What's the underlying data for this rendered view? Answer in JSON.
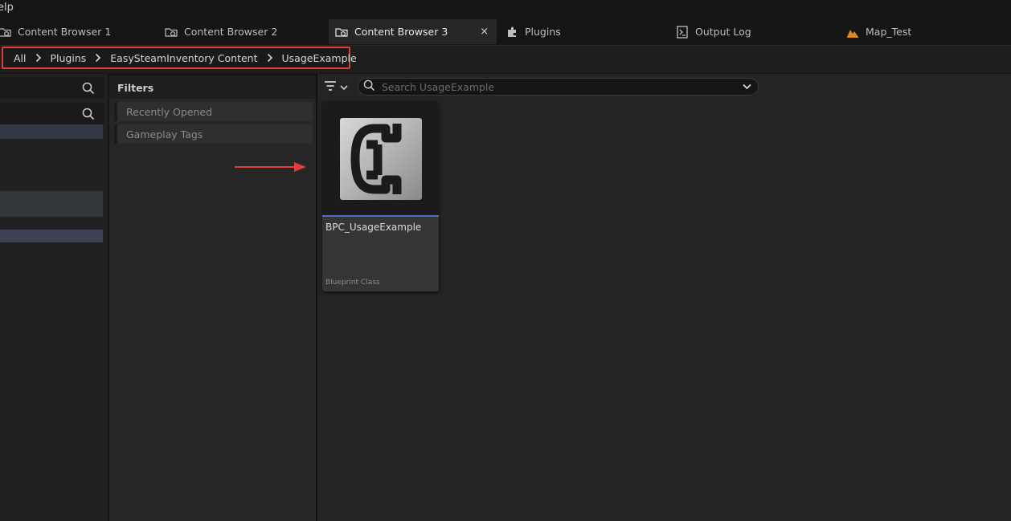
{
  "menu": {
    "help_label": "elp"
  },
  "tabs": [
    {
      "label": "Content Browser 1",
      "icon": "content-browser-icon",
      "active": false
    },
    {
      "label": "Content Browser 2",
      "icon": "content-browser-icon",
      "active": false
    },
    {
      "label": "Content Browser 3",
      "icon": "content-browser-icon",
      "active": true,
      "close": "×"
    },
    {
      "label": "Plugins",
      "icon": "plugins-icon",
      "active": false
    },
    {
      "label": "Output Log",
      "icon": "output-log-icon",
      "active": false
    },
    {
      "label": "Map_Test",
      "icon": "map-icon",
      "active": false
    }
  ],
  "breadcrumb": [
    "All",
    "Plugins",
    "EasySteamInventory Content",
    "UsageExample"
  ],
  "filters": {
    "title": "Filters",
    "items": [
      "Recently Opened",
      "Gameplay Tags"
    ]
  },
  "search": {
    "placeholder": "Search UsageExample",
    "value": ""
  },
  "assets": [
    {
      "name": "BPC_UsageExample",
      "type": "Blueprint Class",
      "icon": "blueprint-class-icon"
    }
  ],
  "colors": {
    "highlight_box": "#e03c3c",
    "annotation_arrow": "#e03c3c",
    "asset_accent": "#4b6ec8",
    "map_icon": "#d9882b"
  }
}
